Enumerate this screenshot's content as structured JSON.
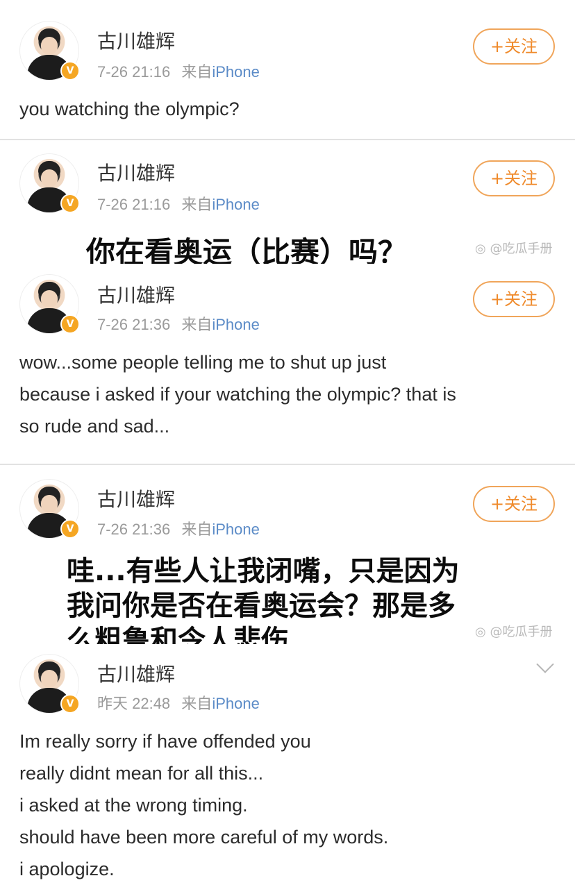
{
  "posts": [
    {
      "username": "古川雄辉",
      "time": "7-26 21:16",
      "source_prefix": "来自",
      "source": "iPhone",
      "follow_label": "+关注",
      "text_lines": [
        "you watching the olympic?"
      ]
    },
    {
      "username": "古川雄辉",
      "time": "7-26 21:16",
      "source_prefix": "来自",
      "source": "iPhone",
      "follow_label": "+关注",
      "caption_lines": [
        "你在看奥运（比赛）吗？"
      ],
      "watermark": "@吃瓜手册"
    },
    {
      "username": "古川雄辉",
      "time": "7-26 21:36",
      "source_prefix": "来自",
      "source": "iPhone",
      "follow_label": "+关注",
      "text_lines": [
        "wow...some people telling me to shut up  just",
        "because i asked if your watching the olympic? that is",
        "so rude and sad..."
      ]
    },
    {
      "username": "古川雄辉",
      "time": "7-26 21:36",
      "source_prefix": "来自",
      "source": "iPhone",
      "follow_label": "+关注",
      "caption_lines": [
        "哇...有些人让我闭嘴，只是因为",
        "我问你是否在看奥运会？那是多",
        "么粗鲁和令人悲伤……"
      ],
      "watermark": "@吃瓜手册"
    },
    {
      "username": "古川雄辉",
      "time": "昨天 22:48",
      "source_prefix": "来自",
      "source": "iPhone",
      "text_lines": [
        "Im really sorry if have offended you",
        "really didnt mean for all this...",
        "i asked at the wrong timing.",
        "should have been more careful of my words.",
        "i apologize."
      ]
    }
  ],
  "colors": {
    "follow_orange": "#ef8a2b",
    "source_blue": "#5b8bc7",
    "verified_badge": "#f5a623"
  }
}
